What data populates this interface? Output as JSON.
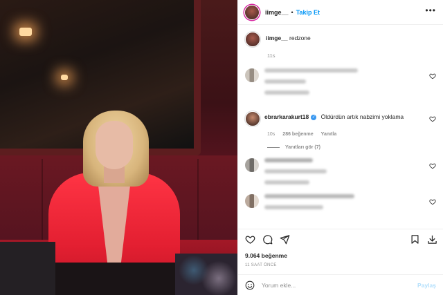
{
  "post": {
    "username": "iimge__",
    "follow_label": "Takip Et",
    "separator": "•",
    "more_icon": "•••"
  },
  "caption": {
    "username": "iimge__",
    "text": "redzone",
    "time": "11s"
  },
  "comments": [
    {
      "blurred": true
    },
    {
      "username": "ebrarkarakurt18",
      "verified": true,
      "text": "Öldürdün artık nabzimi yoklama",
      "time": "10s",
      "likes": "286 beğenme",
      "reply_label": "Yanıtla",
      "view_replies": "Yanıtları gör (7)"
    },
    {
      "blurred": true
    },
    {
      "blurred": true
    }
  ],
  "actions": {
    "icons": [
      "heart-icon",
      "comment-icon",
      "share-icon",
      "bookmark-icon",
      "download-icon"
    ]
  },
  "likes": "9.064 beğenme",
  "posted_ago": "11 SAAT ÖNCE",
  "add_comment": {
    "placeholder": "Yorum ekle...",
    "submit_label": "Paylaş"
  },
  "colors": {
    "accent": "#0095f6",
    "verified": "#3897f0",
    "share_disabled": "#b2dffc"
  }
}
